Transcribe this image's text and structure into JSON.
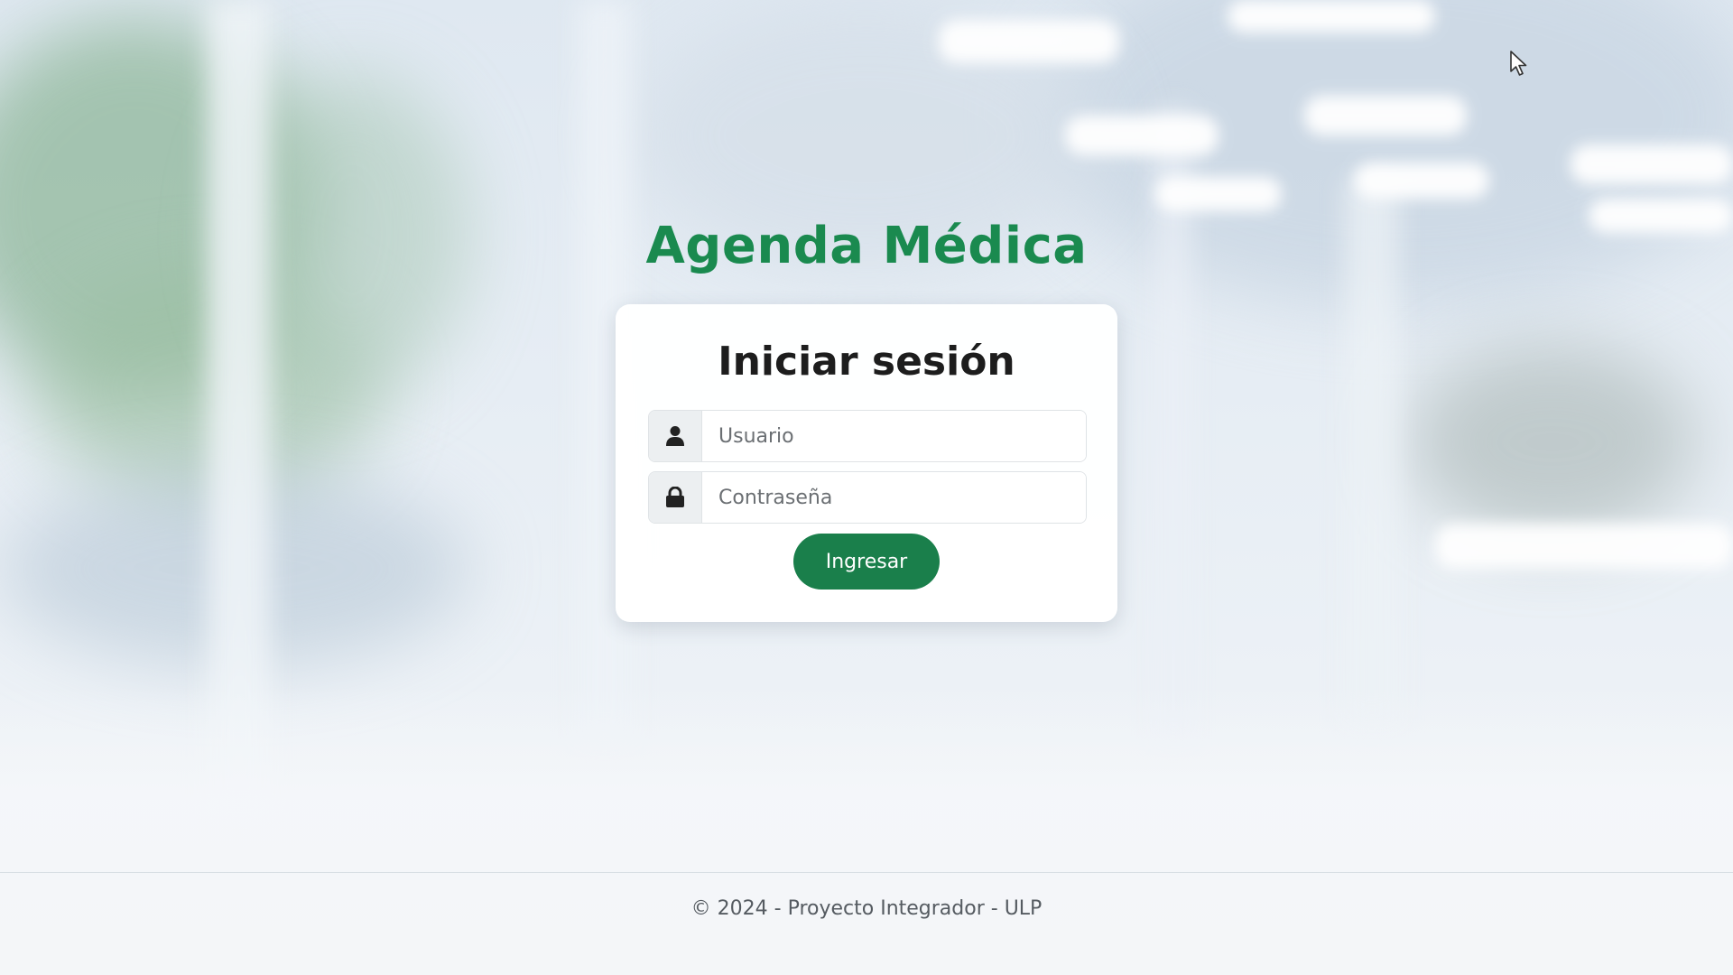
{
  "app": {
    "title": "Agenda Médica",
    "accent_color": "#1a8a4f"
  },
  "login": {
    "heading": "Iniciar sesión",
    "username": {
      "placeholder": "Usuario",
      "value": "",
      "icon": "user-icon"
    },
    "password": {
      "placeholder": "Contraseña",
      "value": "",
      "icon": "lock-icon"
    },
    "submit_label": "Ingresar",
    "submit_color": "#1a7f4b"
  },
  "footer": {
    "text": "© 2024 - Proyecto Integrador - ULP"
  }
}
